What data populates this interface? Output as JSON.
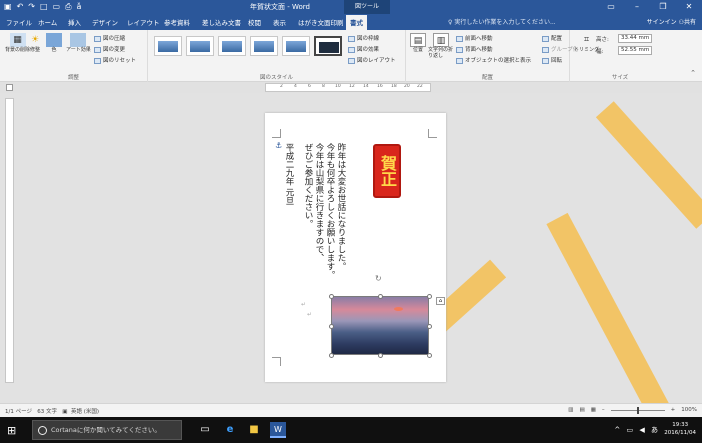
{
  "window": {
    "doc_title": "年賀状文面 - Word",
    "context_tab": "図ツール",
    "user": "サインイン",
    "share": "共有"
  },
  "tabs": [
    "ファイル",
    "ホーム",
    "挿入",
    "デザイン",
    "レイアウト",
    "参考資料",
    "差し込み文書",
    "校閲",
    "表示",
    "はがき文面印刷",
    "書式"
  ],
  "tell_me": "実行したい作業を入力してください...",
  "ribbon": {
    "adjust": {
      "label": "調整",
      "remove_bg": "背景の削除",
      "corrections": "修整",
      "color": "色",
      "artistic": "アート効果",
      "compress": "図の圧縮",
      "change": "図の変更",
      "reset": "図のリセット"
    },
    "styles": {
      "label": "図のスタイル",
      "border": "図の枠線",
      "effects": "図の効果",
      "layout": "図のレイアウト"
    },
    "arrange": {
      "label": "配置",
      "position": "位置",
      "wrap": "文字列の折り返し",
      "forward": "前面へ移動",
      "backward": "背面へ移動",
      "selection_pane": "オブジェクトの選択と表示",
      "align": "配置",
      "group": "グループ化",
      "rotate": "回転"
    },
    "size": {
      "label": "サイズ",
      "crop": "トリミング",
      "height_label": "高さ:",
      "height": "33.44 mm",
      "width_label": "幅:",
      "width": "52.55 mm"
    }
  },
  "ruler_ticks": [
    "2",
    "4",
    "6",
    "8",
    "10",
    "12",
    "14",
    "16",
    "18",
    "20",
    "22"
  ],
  "document": {
    "greeting_lines": [
      "昨年は大変お世話になりました。",
      "今年も何卒よろしくお願いします。",
      "今年は山梨県に行きますので、",
      "ぜひご参加ください。"
    ],
    "date": "平成二九年 元旦",
    "stamp_text": "賀正"
  },
  "status": {
    "page": "1/1 ページ",
    "words": "63 文字",
    "lang": "英語 (米国)",
    "zoom": "100%"
  },
  "taskbar": {
    "search_placeholder": "Cortanaに何か聞いてみてください。",
    "time": "19:33",
    "date": "2016/11/04"
  }
}
